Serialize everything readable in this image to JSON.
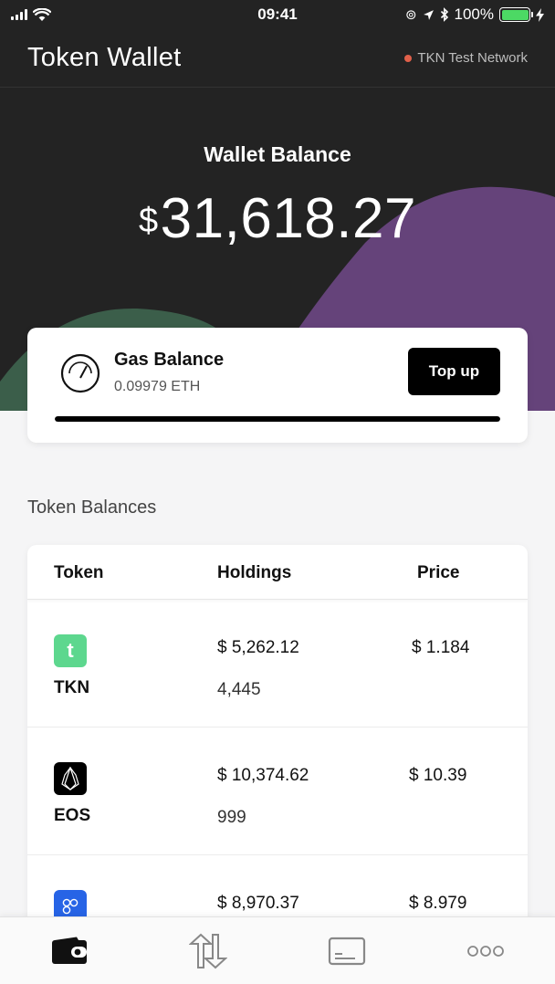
{
  "status_bar": {
    "time": "09:41",
    "battery_percent": "100%"
  },
  "header": {
    "title": "Token Wallet",
    "network": "TKN Test Network"
  },
  "hero": {
    "label": "Wallet Balance",
    "currency": "$",
    "amount": "31,618.27",
    "colors": {
      "bg": "#232323",
      "purple": "#65437a",
      "green": "#3b5e4a"
    }
  },
  "gas": {
    "title": "Gas Balance",
    "value": "0.09979 ETH",
    "button": "Top up",
    "bar_fraction": 1.0
  },
  "tokens": {
    "section_title": "Token Balances",
    "headers": {
      "token": "Token",
      "holdings": "Holdings",
      "price": "Price"
    },
    "rows": [
      {
        "symbol": "TKN",
        "icon": "tkn-icon",
        "icon_glyph": "t",
        "icon_color": "#5dd78e",
        "holding_usd": "$ 5,262.12",
        "holding_amount": "4,445",
        "price": "$ 1.184"
      },
      {
        "symbol": "EOS",
        "icon": "eos-icon",
        "icon_glyph": "",
        "icon_color": "#000000",
        "holding_usd": "$ 10,374.62",
        "holding_amount": "999",
        "price": "$ 10.39"
      },
      {
        "symbol": "",
        "icon": "token-icon-blue",
        "icon_glyph": "",
        "icon_color": "#2764e6",
        "holding_usd": "$ 8,970.37",
        "holding_amount": "",
        "price": "$ 8.979"
      }
    ]
  },
  "tab_bar": {
    "items": [
      "wallet-icon",
      "transfer-icon",
      "card-icon",
      "more-icon"
    ]
  }
}
